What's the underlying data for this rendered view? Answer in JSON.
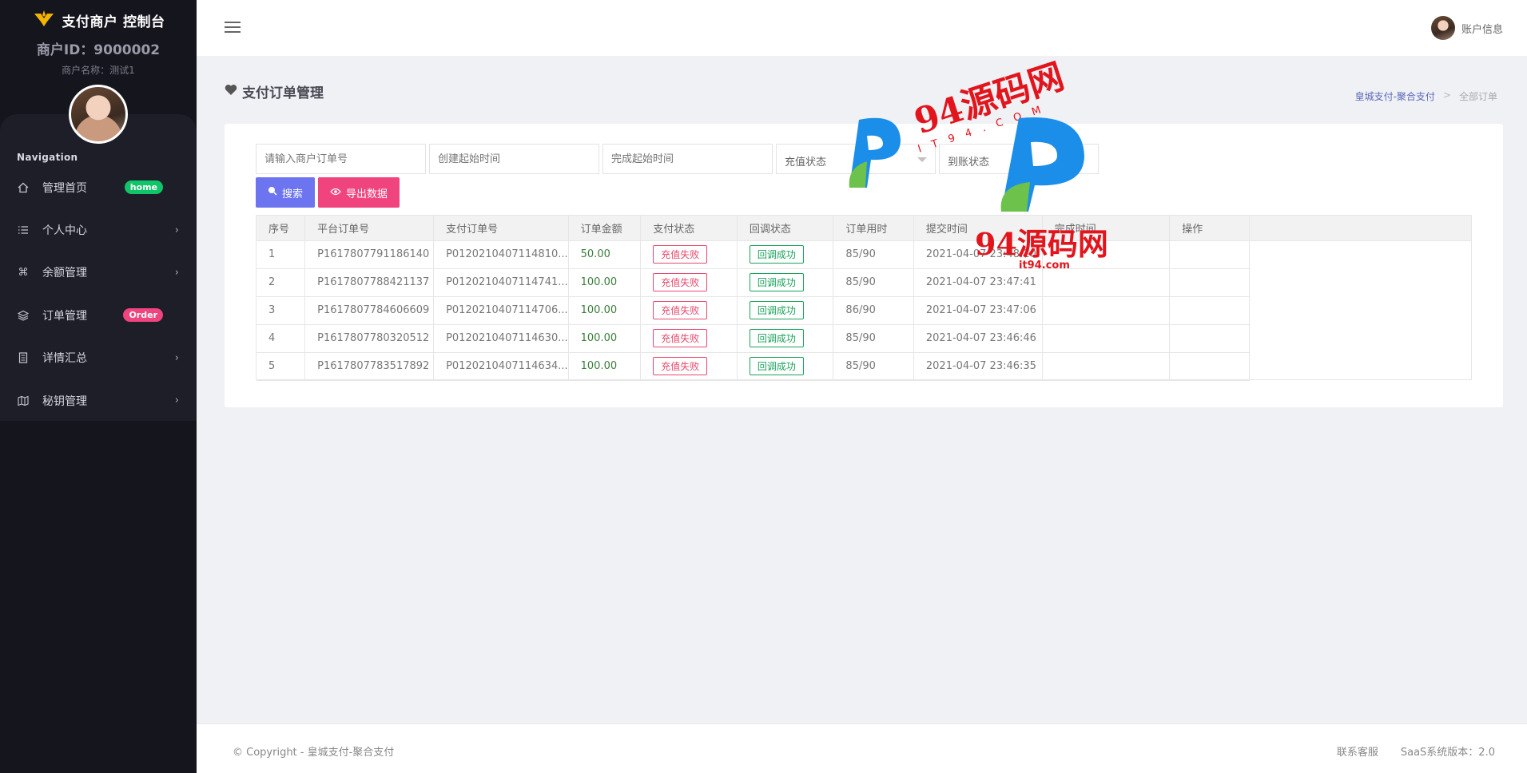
{
  "brand": {
    "title": "支付商户 控制台"
  },
  "merchant": {
    "id_label": "商户ID：9000002",
    "name_label": "商户名称：测试1"
  },
  "nav": {
    "heading": "Navigation",
    "items": [
      {
        "label": "管理首页",
        "icon": "home-icon",
        "badge": "home",
        "arrow": false
      },
      {
        "label": "个人中心",
        "icon": "list-icon",
        "badge": "",
        "arrow": true
      },
      {
        "label": "余额管理",
        "icon": "command-icon",
        "badge": "",
        "arrow": true
      },
      {
        "label": "订单管理",
        "icon": "layers-icon",
        "badge": "Order",
        "arrow": false
      },
      {
        "label": "详情汇总",
        "icon": "document-icon",
        "badge": "",
        "arrow": true
      },
      {
        "label": "秘钥管理",
        "icon": "map-icon",
        "badge": "",
        "arrow": true
      }
    ]
  },
  "topbar": {
    "account_label": "账户信息"
  },
  "page": {
    "title": "支付订单管理"
  },
  "breadcrumb": {
    "link": "皇城支付-聚合支付",
    "separator": ">",
    "current": "全部订单"
  },
  "filters": {
    "merchant_order_placeholder": "请输入商户订单号",
    "create_time_placeholder": "创建起始时间",
    "complete_time_placeholder": "完成起始时间",
    "recharge_status": "充值状态",
    "arrival_status": "到账状态"
  },
  "buttons": {
    "search": "搜索",
    "export": "导出数据"
  },
  "table": {
    "headers": [
      "序号",
      "平台订单号",
      "支付订单号",
      "订单金额",
      "支付状态",
      "回调状态",
      "订单用时",
      "提交时间",
      "完成时间",
      "操作"
    ],
    "rows": [
      [
        "1",
        "P1617807791186140",
        "P0120210407114810...",
        "50.00",
        "充值失败",
        "回调成功",
        "85/90",
        "2021-04-07 23:48:10",
        "",
        ""
      ],
      [
        "2",
        "P1617807788421137",
        "P0120210407114741...",
        "100.00",
        "充值失败",
        "回调成功",
        "85/90",
        "2021-04-07 23:47:41",
        "",
        ""
      ],
      [
        "3",
        "P1617807784606609",
        "P0120210407114706...",
        "100.00",
        "充值失败",
        "回调成功",
        "86/90",
        "2021-04-07 23:47:06",
        "",
        ""
      ],
      [
        "4",
        "P1617807780320512",
        "P0120210407114630...",
        "100.00",
        "充值失败",
        "回调成功",
        "85/90",
        "2021-04-07 23:46:46",
        "",
        ""
      ],
      [
        "5",
        "P1617807783517892",
        "P0120210407114634...",
        "100.00",
        "充值失败",
        "回调成功",
        "85/90",
        "2021-04-07 23:46:35",
        "",
        ""
      ]
    ]
  },
  "footer": {
    "copyright": "© Copyright - 皇城支付-聚合支付",
    "contact": "联系客服",
    "version": "SaaS系统版本：2.0"
  },
  "watermark": {
    "text1": "94源码网",
    "text2": "IT94.COM",
    "text3": "94源码网",
    "text4": "it94.com"
  }
}
